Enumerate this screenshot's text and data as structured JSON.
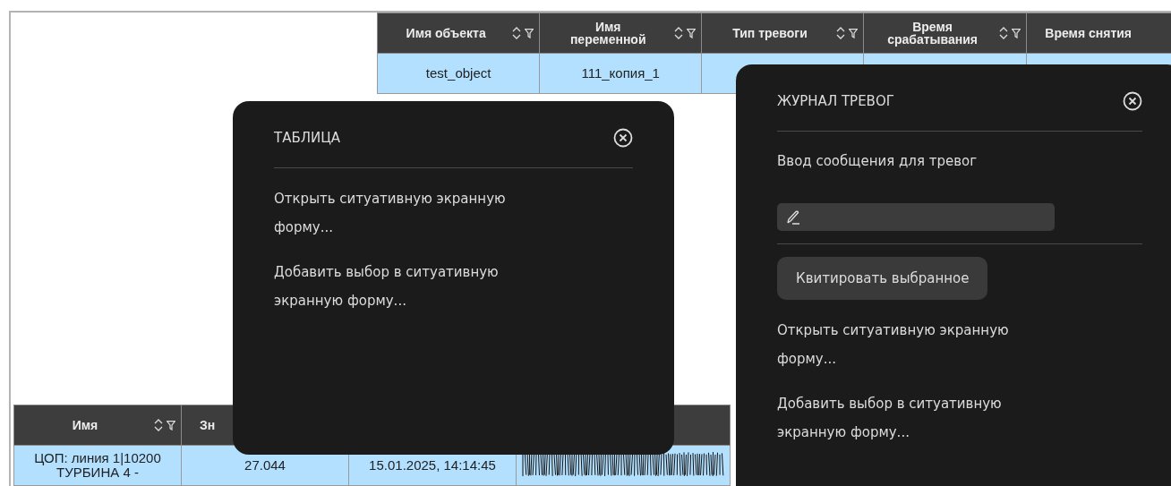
{
  "top_table": {
    "columns": [
      {
        "label": "Имя объекта",
        "sortable": true
      },
      {
        "label": "Имя\nпеременной",
        "sortable": true
      },
      {
        "label": "Тип тревоги",
        "sortable": true
      },
      {
        "label": "Время\nсрабатывания",
        "sortable": true
      },
      {
        "label": "Время снятия",
        "sortable": false
      }
    ],
    "rows": [
      {
        "cells": [
          "test_object",
          "111_копия_1"
        ],
        "selected": true
      }
    ]
  },
  "bottom_table": {
    "columns": [
      {
        "label": "Имя",
        "sortable": true
      },
      {
        "label": "Зн",
        "sortable": false
      },
      {},
      {}
    ],
    "rows": [
      {
        "cells": [
          "ЦОП: линия 1|10200\nТУРБИНА 4 -",
          "27.044",
          "15.01.2025, 14:14:45",
          {
            "kind": "waveform"
          }
        ],
        "selected": true
      }
    ]
  },
  "popups": [
    {
      "title": "ТАБЛИЦА",
      "sections": [
        {
          "kind": "item",
          "text": "Открыть ситуативную экранную\nформу..."
        },
        {
          "kind": "item",
          "text": "Добавить выбор в ситуативную\nэкранную форму..."
        }
      ]
    },
    {
      "title": "ЖУРНАЛ ТРЕВОГ",
      "sections": [
        {
          "kind": "label",
          "text": "Ввод сообщения для тревог"
        },
        {
          "kind": "field"
        },
        {
          "kind": "divider"
        },
        {
          "kind": "button",
          "text": "Квитировать выбранное"
        },
        {
          "kind": "item",
          "text": "Открыть ситуативную экранную\nформу..."
        },
        {
          "kind": "item",
          "text": "Добавить выбор в ситуативную\nэкранную форму..."
        }
      ]
    }
  ]
}
